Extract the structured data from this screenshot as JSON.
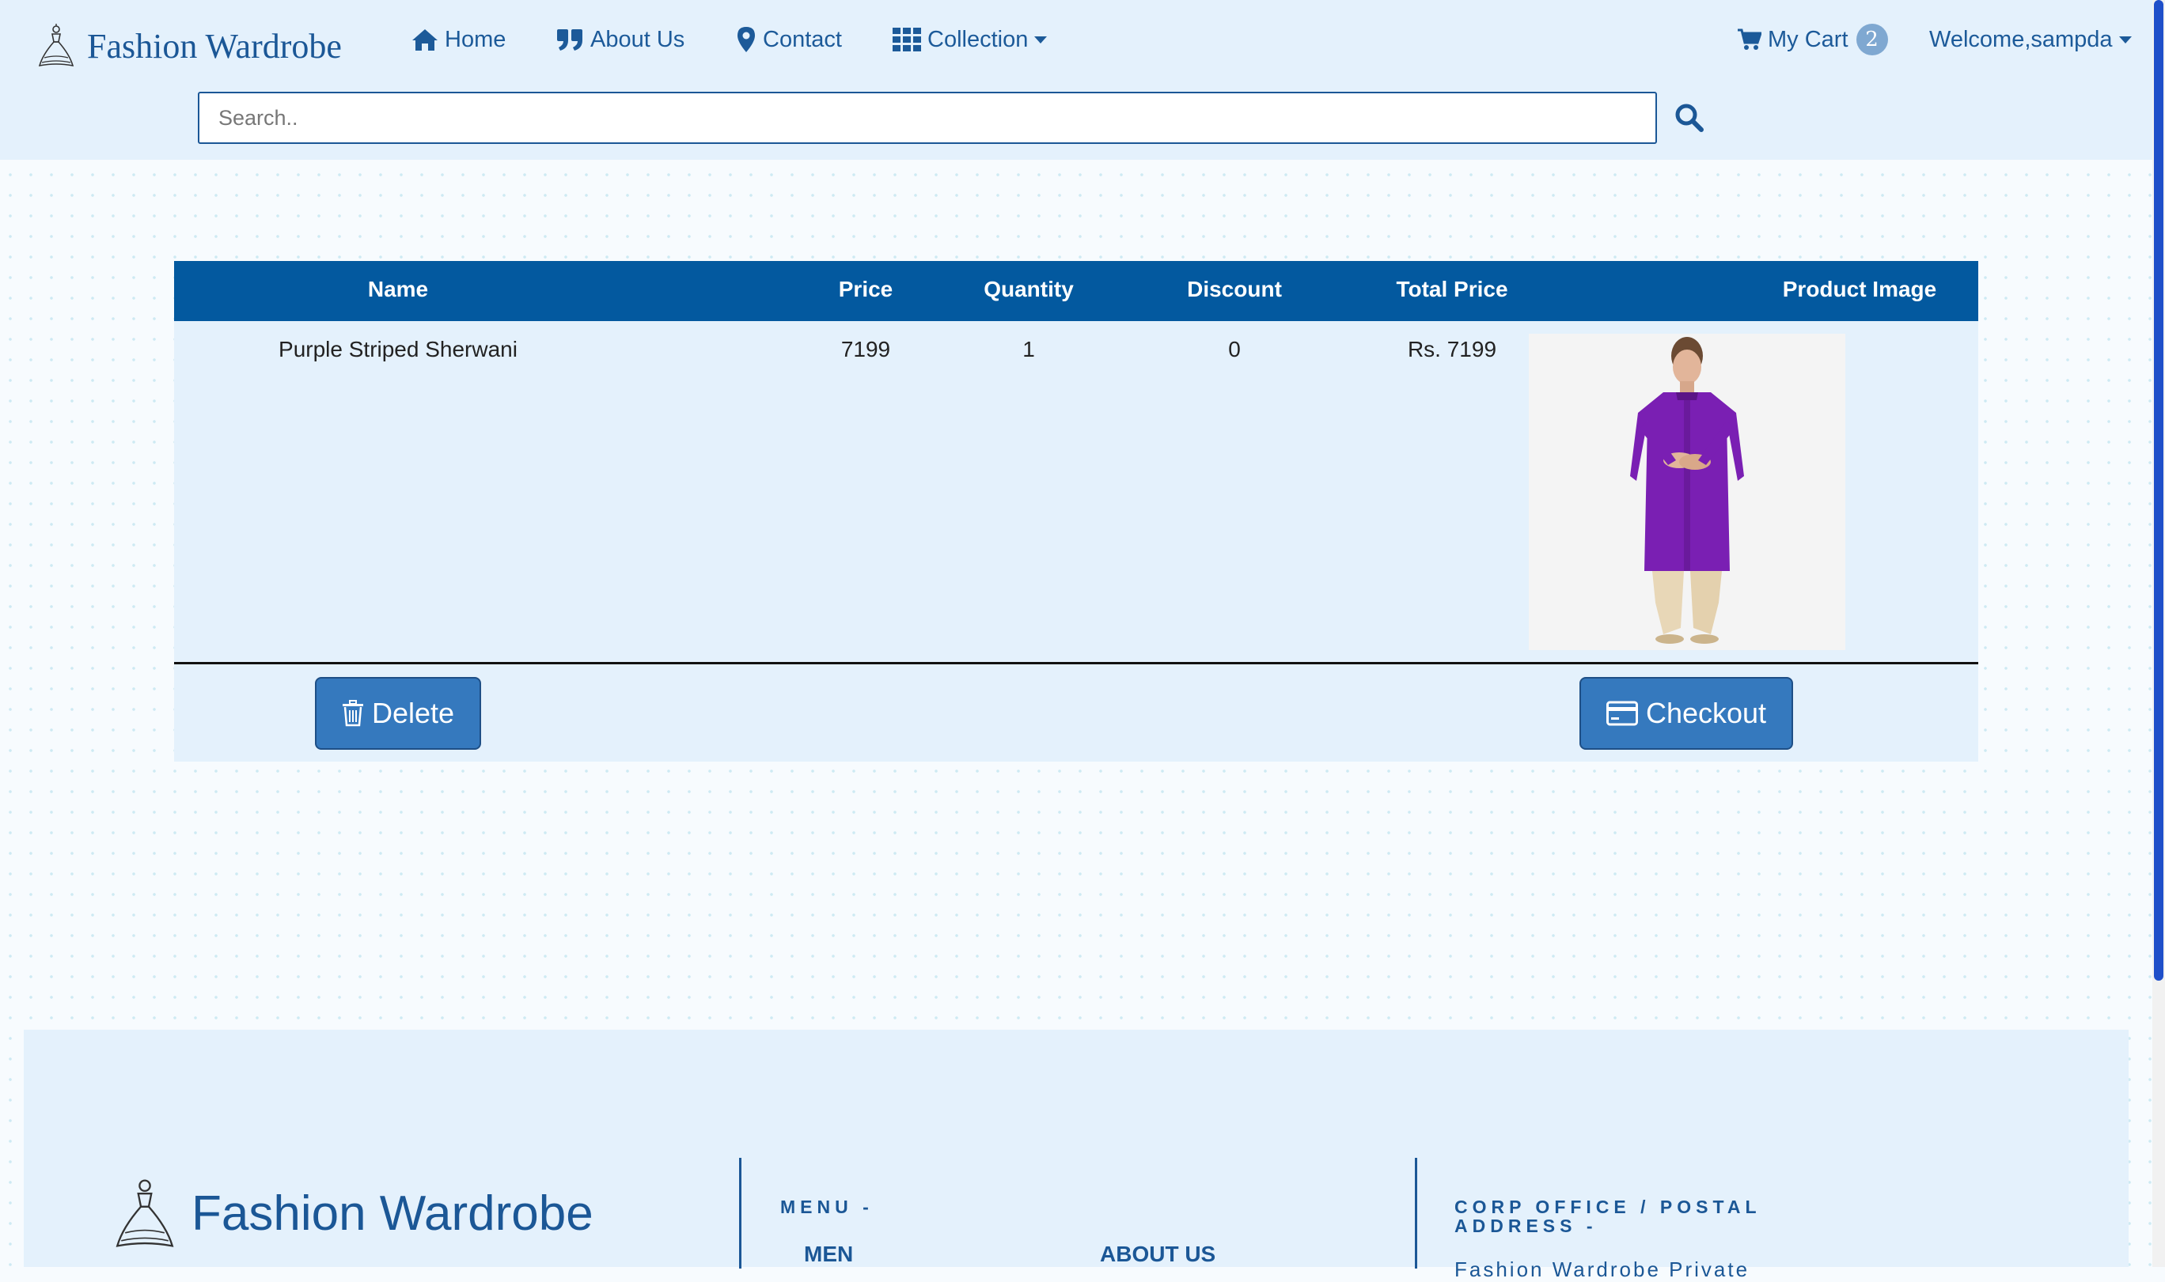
{
  "header": {
    "brand": "Fashion Wardrobe",
    "nav": {
      "home": "Home",
      "about": "About Us",
      "contact": "Contact",
      "collection": "Collection",
      "cart": "My Cart",
      "cart_count": "2",
      "user": "Welcome,sampda"
    },
    "search": {
      "placeholder": "Search..",
      "value": ""
    }
  },
  "cart": {
    "columns": [
      "Name",
      "Price",
      "Quantity",
      "Discount",
      "Total Price",
      "Product Image"
    ],
    "rows": [
      {
        "name": "Purple Striped Sherwani",
        "price": "7199",
        "quantity": "1",
        "discount": "0",
        "total": "Rs. 7199",
        "image_alt": "purple sherwani product image"
      }
    ],
    "delete_label": "Delete",
    "checkout_label": "Checkout"
  },
  "footer": {
    "brand": "Fashion Wardrobe",
    "menu_heading": "MENU -",
    "office_heading": "CORP OFFICE / POSTAL ADDRESS -",
    "links": {
      "men": "MEN",
      "about": "ABOUT US"
    },
    "address_snippet": "Fashion Wardrobe Private"
  },
  "icons": {
    "home": "home-icon",
    "about": "quote-icon",
    "contact": "map-marker-icon",
    "collection": "grid-icon",
    "cart": "shopping-cart-icon",
    "search": "search-icon",
    "delete": "trash-icon",
    "checkout": "credit-card-icon"
  },
  "colors": {
    "primary": "#03599f",
    "header_bg": "#e4f1fc",
    "button": "#3579be",
    "product_purple": "#7a1fb3"
  }
}
